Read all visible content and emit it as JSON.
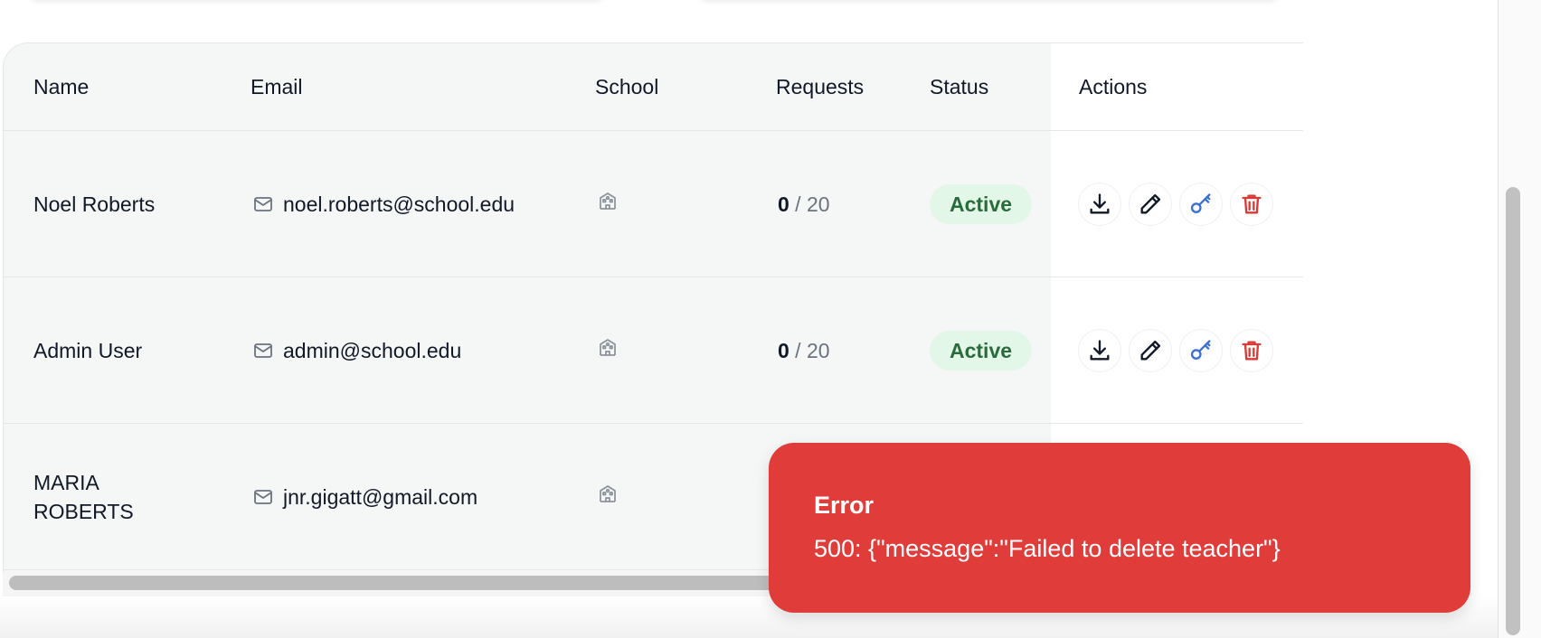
{
  "table": {
    "headers": {
      "name": "Name",
      "email": "Email",
      "school": "School",
      "requests": "Requests",
      "status": "Status",
      "actions": "Actions"
    },
    "rows": [
      {
        "name": "Noel Roberts",
        "email": "noel.roberts@school.edu",
        "requests_used": "0",
        "requests_sep": " / 20",
        "status": "Active"
      },
      {
        "name": "Admin User",
        "email": "admin@school.edu",
        "requests_used": "0",
        "requests_sep": " / 20",
        "status": "Active"
      },
      {
        "name_line1": "MARIA",
        "name_line2": "ROBERTS",
        "email": "jnr.gigatt@gmail.com"
      }
    ],
    "icons": {
      "email": "mail-icon",
      "school": "school-building-icon",
      "download": "download-icon",
      "edit": "pencil-icon",
      "key": "key-icon",
      "delete": "trash-icon"
    }
  },
  "toast": {
    "title": "Error",
    "message": "500: {\"message\":\"Failed to delete teacher\"}"
  },
  "colors": {
    "status_active_bg": "#e3f7e8",
    "status_active_text": "#2a6b3c",
    "toast_bg": "#e03c3a",
    "key_icon": "#3b6fd4",
    "delete_icon": "#d93a34"
  }
}
